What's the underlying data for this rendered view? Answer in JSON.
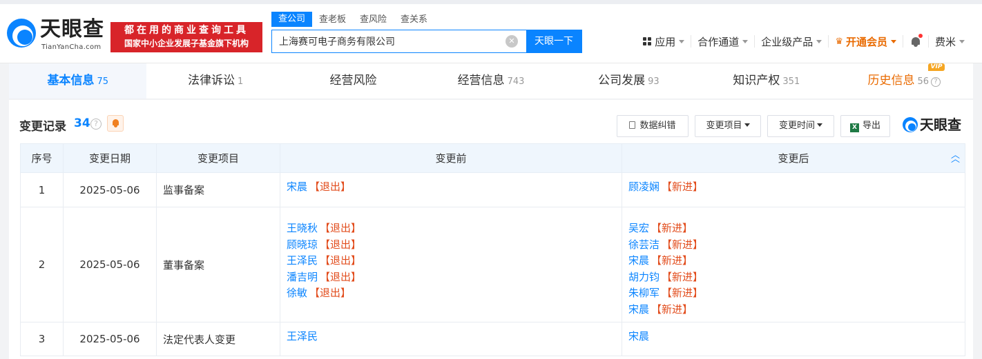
{
  "header": {
    "logo_text": "天眼查",
    "logo_sub": "TianYanCha.com",
    "slogan_line1": "都在用的商业查询工具",
    "slogan_line2": "国家中小企业发展子基金旗下机构",
    "search_tabs": [
      "查公司",
      "查老板",
      "查风险",
      "查关系"
    ],
    "search_value": "上海赛可电子商务有限公司",
    "search_button": "天眼一下",
    "nav": {
      "apps": "应用",
      "channels": "合作通道",
      "enterprise": "企业级产品",
      "vip": "开通会员",
      "user": "费米"
    }
  },
  "tabs": [
    {
      "label": "基本信息",
      "count": "75"
    },
    {
      "label": "法律诉讼",
      "count": "1"
    },
    {
      "label": "经营风险",
      "count": ""
    },
    {
      "label": "经营信息",
      "count": "743"
    },
    {
      "label": "公司发展",
      "count": "93"
    },
    {
      "label": "知识产权",
      "count": "351"
    },
    {
      "label": "历史信息",
      "count": "56",
      "badge": "VIP"
    }
  ],
  "section": {
    "title": "变更记录",
    "count": "34",
    "buttons": {
      "correct": "数据纠错",
      "item_filter": "变更项目",
      "time_filter": "变更时间",
      "export": "导出"
    },
    "watermark": "天眼查"
  },
  "table": {
    "headers": [
      "序号",
      "变更日期",
      "变更项目",
      "变更前",
      "变更后"
    ],
    "rows": [
      {
        "no": "1",
        "date": "2025-05-06",
        "item": "监事备案",
        "before": [
          {
            "name": "宋晨",
            "tag": "【退出】"
          }
        ],
        "after": [
          {
            "name": "顾凌娴",
            "tag": "【新进】"
          }
        ]
      },
      {
        "no": "2",
        "date": "2025-05-06",
        "item": "董事备案",
        "before": [
          {
            "name": "王晓秋",
            "tag": "【退出】"
          },
          {
            "name": "顾晓琼",
            "tag": "【退出】"
          },
          {
            "name": "王泽民",
            "tag": "【退出】"
          },
          {
            "name": "潘吉明",
            "tag": "【退出】"
          },
          {
            "name": "徐敏",
            "tag": "【退出】"
          }
        ],
        "after": [
          {
            "name": "吴宏",
            "tag": "【新进】"
          },
          {
            "name": "徐芸洁",
            "tag": "【新进】"
          },
          {
            "name": "宋晨",
            "tag": "【新进】"
          },
          {
            "name": "胡力钧",
            "tag": "【新进】"
          },
          {
            "name": "朱柳军",
            "tag": "【新进】"
          },
          {
            "name": "宋晨",
            "tag": "【新进】"
          }
        ]
      },
      {
        "no": "3",
        "date": "2025-05-06",
        "item": "法定代表人变更",
        "before": [
          {
            "name": "王泽民",
            "tag": ""
          }
        ],
        "after": [
          {
            "name": "宋晨",
            "tag": ""
          }
        ]
      }
    ]
  },
  "colors": {
    "brand_blue": "#0a84ff",
    "slogan_red": "#d82429",
    "vip_orange": "#e96a00",
    "tag_red": "#e24c1c"
  }
}
